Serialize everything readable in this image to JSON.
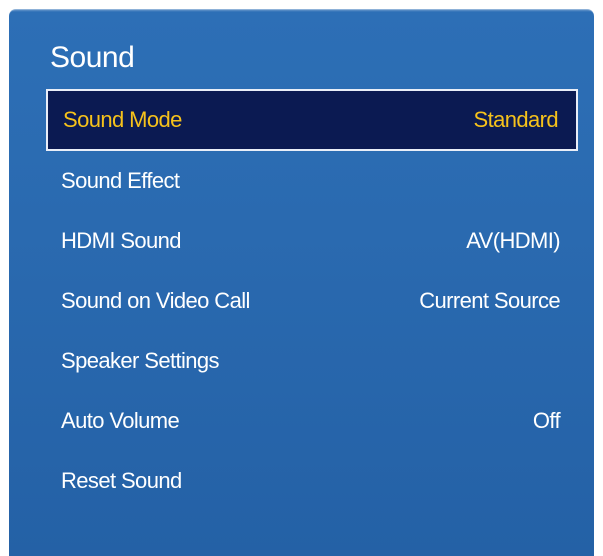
{
  "menu": {
    "title": "Sound",
    "items": [
      {
        "label": "Sound Mode",
        "value": "Standard",
        "selected": true
      },
      {
        "label": "Sound Effect",
        "value": ""
      },
      {
        "label": "HDMI Sound",
        "value": "AV(HDMI)"
      },
      {
        "label": "Sound on Video Call",
        "value": "Current Source"
      },
      {
        "label": "Speaker Settings",
        "value": ""
      },
      {
        "label": "Auto Volume",
        "value": "Off"
      },
      {
        "label": "Reset Sound",
        "value": ""
      }
    ]
  },
  "colors": {
    "panel": "#2a6ab0",
    "selected_bg": "#0b1a52",
    "selected_text": "#f6c21b",
    "text": "#ffffff"
  }
}
